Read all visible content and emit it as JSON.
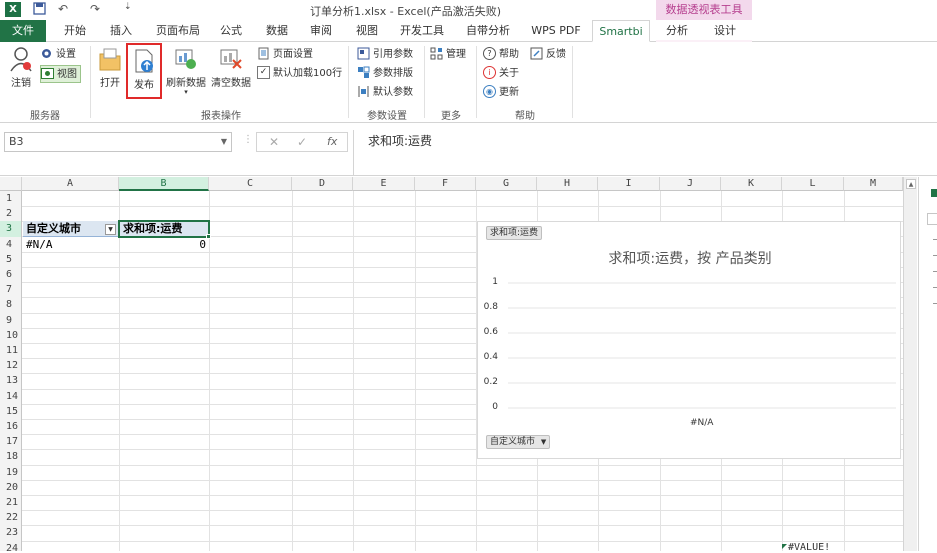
{
  "title_bar": {
    "doc_title": "订单分析1.xlsx - Excel(产品激活失败)",
    "pivot_tools": "数据透视表工具",
    "qat_undo": "↶",
    "qat_redo": "↷",
    "qat_more": "⇣"
  },
  "tabs": [
    "文件",
    "开始",
    "插入",
    "页面布局",
    "公式",
    "数据",
    "审阅",
    "视图",
    "开发工具",
    "自带分析",
    "WPS PDF",
    "Smartbi",
    "分析",
    "设计"
  ],
  "ribbon": {
    "server": {
      "logout": "注销",
      "settings": "设置",
      "view": "视图",
      "label": "服务器"
    },
    "report_ops": {
      "open": "打开",
      "publish": "发布",
      "refresh": "刷新数据",
      "clear": "清空数据",
      "page_setup": "页面设置",
      "default_load": "默认加载100行",
      "label": "报表操作"
    },
    "params": {
      "ref_params": "引用参数",
      "param_sort": "参数排版",
      "default_params": "默认参数",
      "label": "参数设置"
    },
    "more": {
      "manage": "管理",
      "label": "更多"
    },
    "help": {
      "help": "帮助",
      "feedback": "反馈",
      "about": "关于",
      "update": "更新",
      "label": "帮助"
    }
  },
  "formula_bar": {
    "name_box": "B3",
    "cancel": "✕",
    "enter": "✓",
    "fx": "fx",
    "content": "求和项:运费"
  },
  "columns": [
    "A",
    "B",
    "C",
    "D",
    "E",
    "F",
    "G",
    "H",
    "I",
    "J",
    "K",
    "L",
    "M"
  ],
  "rows": [
    "1",
    "2",
    "3",
    "4",
    "5",
    "6",
    "7",
    "8",
    "9",
    "10",
    "11",
    "12",
    "13",
    "14",
    "15",
    "16",
    "17",
    "18",
    "19",
    "20",
    "21",
    "22",
    "23",
    "24"
  ],
  "cells": {
    "A3": "自定义城市",
    "B3": "求和项:运费",
    "A4": "#N/A",
    "B4": "0",
    "L24": "#VALUE!"
  },
  "chart_data": {
    "type": "bar",
    "title": "求和项:运费，按 产品类别",
    "value_field_button": "求和项:运费",
    "axis_field_button": "自定义城市",
    "categories": [
      "#N/A"
    ],
    "series": [
      {
        "values": [
          0
        ]
      }
    ],
    "ylim": [
      0,
      1
    ],
    "yticks": [
      "1",
      "0.8",
      "0.6",
      "0.4",
      "0.2",
      "0"
    ],
    "grid": true
  }
}
